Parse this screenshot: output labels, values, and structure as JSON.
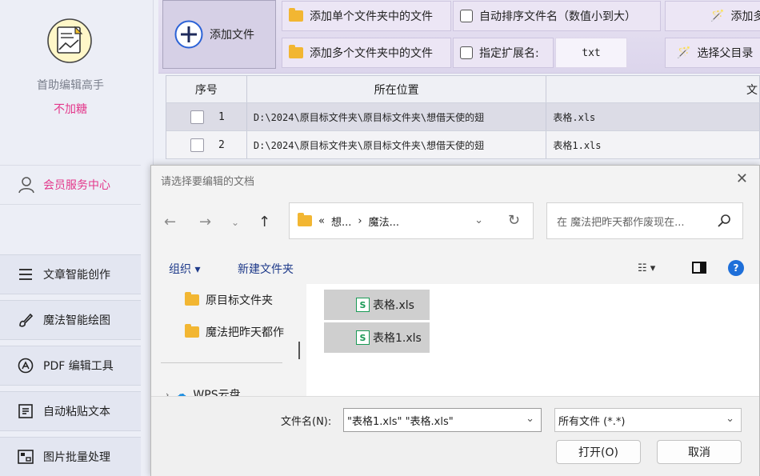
{
  "sidebar": {
    "app_name": "首助编辑高手",
    "app_sub": "不加糖",
    "vip_label": "会员服务中心",
    "items": [
      {
        "label": "文章智能创作"
      },
      {
        "label": "魔法智能绘图"
      },
      {
        "label": "PDF 编辑工具"
      },
      {
        "label": "自动粘贴文本"
      },
      {
        "label": "图片批量处理"
      }
    ]
  },
  "toolbar": {
    "add_file": "添加文件",
    "add_single_folder": "添加单个文件夹中的文件",
    "add_multi_folder": "添加多个文件夹中的文件",
    "auto_sort": "自动排序文件名（数值小到大）",
    "ext_label": "指定扩展名:",
    "ext_value": "txt",
    "add_more": "添加多",
    "choose_parent": "选择父目录"
  },
  "table": {
    "headers": [
      "序号",
      "所在位置",
      "文"
    ],
    "rows": [
      {
        "num": "1",
        "path": "D:\\2024\\原目标文件夹\\原目标文件夹\\想借天使的翅",
        "name": "表格.xls"
      },
      {
        "num": "2",
        "path": "D:\\2024\\原目标文件夹\\原目标文件夹\\想借天使的翅",
        "name": "表格1.xls"
      }
    ]
  },
  "dialog": {
    "title": "请选择要编辑的文档",
    "address": {
      "sep": "«",
      "part1": "想...",
      "arrow": "›",
      "part2": "魔法..."
    },
    "search_placeholder": "在 魔法把昨天都作废现在...",
    "organize": "组织 ▾",
    "new_folder": "新建文件夹",
    "view_label": "☷ ▾",
    "help": "?",
    "tree": [
      {
        "label": "原目标文件夹"
      },
      {
        "label": "魔法把昨天都作"
      },
      {
        "label": "WPS云盘"
      }
    ],
    "files": [
      {
        "label": "表格.xls",
        "icon": "S"
      },
      {
        "label": "表格1.xls",
        "icon": "S"
      }
    ],
    "filename_label": "文件名(N):",
    "filename_value": "\"表格1.xls\" \"表格.xls\"",
    "filetype": "所有文件 (*.*)",
    "open_btn": "打开(O)",
    "cancel_btn": "取消"
  },
  "colors": {
    "accent_pink": "#e3388b",
    "toolbar_bg": "#dcd5ec",
    "link_blue": "#1e3a8a",
    "xls_green": "#1a9a56"
  }
}
